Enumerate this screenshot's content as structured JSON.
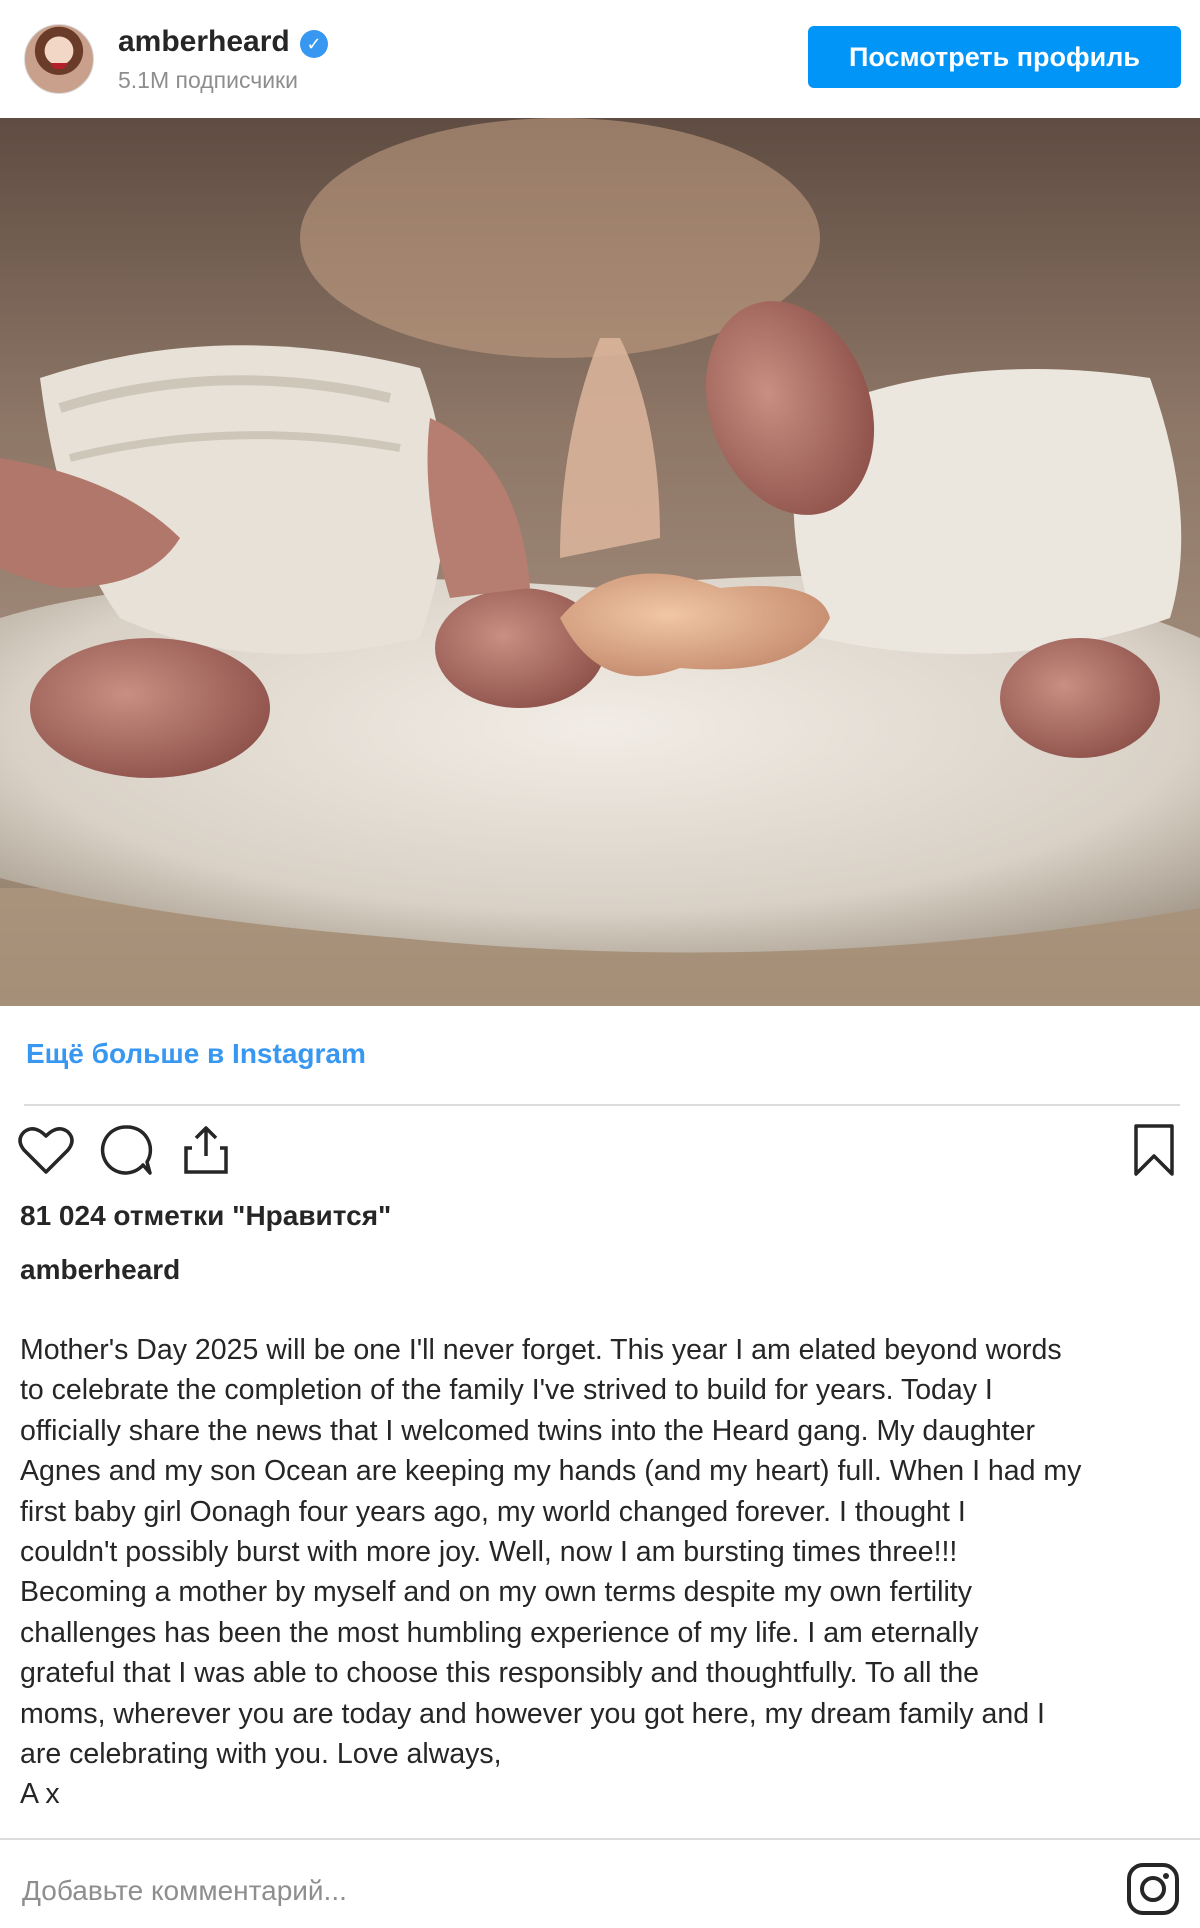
{
  "header": {
    "username": "amberheard",
    "verified_icon": "verified-badge-icon",
    "followers": "5.1M подписчики",
    "view_profile_label": "Посмотреть профиль",
    "accent_color": "#0095f6"
  },
  "post": {
    "more_link": "Ещё больше в Instagram",
    "likes": "81 024 отметки \"Нравится\"",
    "caption_user": "amberheard",
    "caption": "Mother's Day 2025 will be one I'll never forget. This year I am elated beyond words\nto celebrate the completion of the family I've strived to build for years. Today I\nofficially share the news that I welcomed twins into the Heard gang. My daughter\nAgnes and my son Ocean are keeping my hands (and my heart) full. When I had my\nfirst baby girl Oonagh four years ago, my world changed forever. I thought I\ncouldn't possibly burst with more joy. Well, now I am bursting times three!!!\nBecoming a mother by myself and on my own terms despite my own fertility\nchallenges has been the most humbling experience of my life. I am eternally\ngrateful that I was able to choose this responsibly and thoughtfully. To all the\nmoms, wherever you are today and however you got here, my dream family and I\nare celebrating with you. Love always,\nA x"
  },
  "actions": {
    "like_icon": "heart-icon",
    "comment_icon": "comment-bubble-icon",
    "share_icon": "share-icon",
    "save_icon": "bookmark-icon"
  },
  "comment_box": {
    "placeholder": "Добавьте комментарий...",
    "logo_icon": "instagram-icon"
  }
}
